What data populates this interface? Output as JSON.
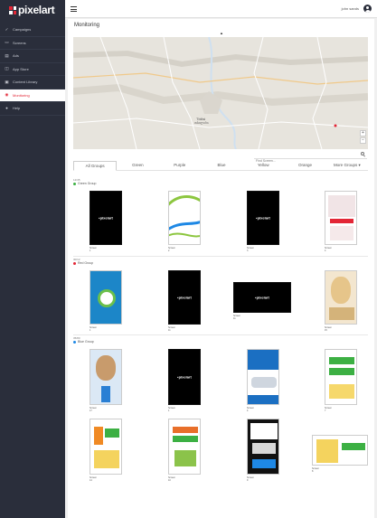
{
  "app": {
    "logo_text": "pixelart"
  },
  "sidebar": {
    "items": [
      {
        "label": "Campaigns",
        "icon": "check-icon",
        "active": false
      },
      {
        "label": "Screens",
        "icon": "monitor-icon",
        "active": false
      },
      {
        "label": "Ads",
        "icon": "ads-icon",
        "active": false
      },
      {
        "label": "App Store",
        "icon": "store-icon",
        "active": false
      },
      {
        "label": "Content Library",
        "icon": "library-icon",
        "active": false
      },
      {
        "label": "Monitoring",
        "icon": "monitoring-icon",
        "active": true
      },
      {
        "label": "Help",
        "icon": "help-icon",
        "active": false
      }
    ]
  },
  "header": {
    "user_name": "john sands"
  },
  "main": {
    "title": "Monitoring",
    "map": {
      "city_label": "Tbilisi",
      "city_label_local": "თბილისი"
    },
    "search": {
      "placeholder": "Find Screen..."
    },
    "tabs": [
      "All Groups",
      "Green",
      "Purple",
      "Blue",
      "Yellow",
      "Orange",
      "More Groups ▾"
    ],
    "groups": [
      {
        "count": "12/45",
        "name": "Green Group",
        "color": "#3cb043",
        "screens": [
          "Screen 1",
          "Screen 2",
          "Screen 3",
          "Screen 4"
        ]
      },
      {
        "count": "30/12",
        "name": "Red Group",
        "color": "#e32636",
        "screens": [
          "Screen 1",
          "Screen 11",
          "Screen 11",
          "Screen 15"
        ]
      },
      {
        "count": "35/80",
        "name": "Blue Group",
        "color": "#1e88e5",
        "screens": [
          "Screen 17",
          "Screen 1",
          "Screen 4",
          "Screen 7",
          "Screen 14",
          "Screen 10",
          "Screen 9",
          "Screen 8"
        ]
      }
    ]
  },
  "colors": {
    "accent": "#e32636",
    "sidebar_bg": "#2a2e3b"
  }
}
